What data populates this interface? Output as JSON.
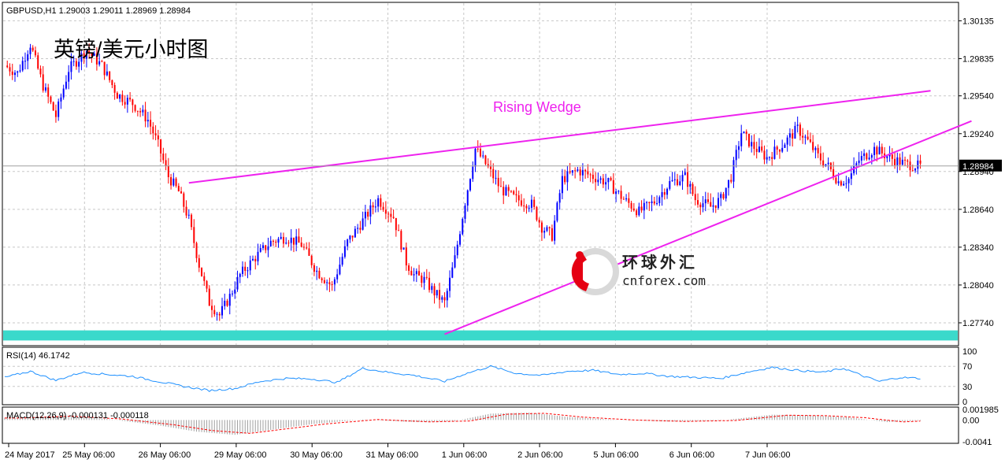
{
  "header": {
    "symbol_line": "GBPUSD,H1  1.29003 1.29011 1.28969 1.28984",
    "cn_title": "英镑/美元小时图"
  },
  "annotations": {
    "pattern_label": "Rising Wedge",
    "watermark_cn": "环球外汇",
    "watermark_url": "cnforex.com"
  },
  "price_axis": {
    "ticks": [
      "1.30135",
      "1.29835",
      "1.29540",
      "1.29240",
      "1.28940",
      "1.28640",
      "1.28340",
      "1.28040",
      "1.27740"
    ],
    "tick_values": [
      1.30135,
      1.29835,
      1.2954,
      1.2924,
      1.2894,
      1.2864,
      1.2834,
      1.2804,
      1.2774
    ],
    "current_price": "1.28984",
    "current_value": 1.28984,
    "range": [
      1.2759,
      1.3025
    ]
  },
  "time_axis": {
    "labels": [
      "24 May 2017",
      "25 May 06:00",
      "26 May 06:00",
      "29 May 06:00",
      "30 May 06:00",
      "31 May 06:00",
      "1 Jun 06:00",
      "2 Jun 06:00",
      "5 Jun 06:00",
      "6 Jun 06:00",
      "7 Jun 06:00"
    ]
  },
  "rsi_panel": {
    "label": "RSI(14) 46.1742",
    "ticks": [
      "100",
      "70",
      "30",
      "0"
    ],
    "tick_values": [
      100,
      70,
      30,
      0
    ]
  },
  "macd_panel": {
    "label": "MACD(12,26,9) -0.000131 -0.000118",
    "ticks": [
      "0.001985",
      "0.00",
      "-0.0041"
    ],
    "tick_values": [
      0.001985,
      0,
      -0.0041
    ]
  },
  "colors": {
    "bull": "#0000ff",
    "bear": "#ff0000",
    "wedge": "#ee22ee",
    "support_band": "#3ad9cb",
    "rsi_line": "#1e90ff",
    "macd_signal": "#ff0000",
    "macd_hist": "#a0a0a0"
  },
  "chart_data": {
    "type": "candlestick",
    "symbol": "GBPUSD",
    "timeframe": "H1",
    "ohlc_last": {
      "open": 1.29003,
      "high": 1.29011,
      "low": 1.28969,
      "close": 1.28984
    },
    "ylim": [
      1.2759,
      1.3025
    ],
    "path_points": [
      [
        0,
        1.2978
      ],
      [
        5,
        1.2972
      ],
      [
        10,
        1.2995
      ],
      [
        15,
        1.2962
      ],
      [
        20,
        1.2938
      ],
      [
        25,
        1.2975
      ],
      [
        32,
        1.299
      ],
      [
        38,
        1.2978
      ],
      [
        44,
        1.2955
      ],
      [
        50,
        1.2948
      ],
      [
        56,
        1.2935
      ],
      [
        60,
        1.2915
      ],
      [
        64,
        1.289
      ],
      [
        68,
        1.2878
      ],
      [
        72,
        1.2856
      ],
      [
        76,
        1.282
      ],
      [
        80,
        1.279
      ],
      [
        84,
        1.278
      ],
      [
        88,
        1.2795
      ],
      [
        92,
        1.2812
      ],
      [
        98,
        1.2826
      ],
      [
        104,
        1.2838
      ],
      [
        110,
        1.2842
      ],
      [
        116,
        1.2836
      ],
      [
        122,
        1.2815
      ],
      [
        128,
        1.2803
      ],
      [
        134,
        1.2838
      ],
      [
        140,
        1.2855
      ],
      [
        146,
        1.2872
      ],
      [
        152,
        1.2858
      ],
      [
        157,
        1.2822
      ],
      [
        160,
        1.2812
      ],
      [
        164,
        1.2808
      ],
      [
        168,
        1.2798
      ],
      [
        172,
        1.279
      ],
      [
        176,
        1.2825
      ],
      [
        180,
        1.287
      ],
      [
        184,
        1.2912
      ],
      [
        188,
        1.29
      ],
      [
        194,
        1.288
      ],
      [
        200,
        1.2872
      ],
      [
        206,
        1.2868
      ],
      [
        210,
        1.285
      ],
      [
        214,
        1.2843
      ],
      [
        218,
        1.2888
      ],
      [
        224,
        1.2895
      ],
      [
        230,
        1.289
      ],
      [
        236,
        1.2885
      ],
      [
        242,
        1.2872
      ],
      [
        248,
        1.2862
      ],
      [
        254,
        1.287
      ],
      [
        260,
        1.2885
      ],
      [
        266,
        1.289
      ],
      [
        270,
        1.2872
      ],
      [
        276,
        1.2866
      ],
      [
        280,
        1.2872
      ],
      [
        284,
        1.289
      ],
      [
        288,
        1.2925
      ],
      [
        292,
        1.2915
      ],
      [
        298,
        1.2905
      ],
      [
        304,
        1.2915
      ],
      [
        310,
        1.2928
      ],
      [
        314,
        1.2918
      ],
      [
        318,
        1.2906
      ],
      [
        322,
        1.2898
      ],
      [
        326,
        1.2886
      ],
      [
        330,
        1.2888
      ],
      [
        334,
        1.2903
      ],
      [
        340,
        1.2912
      ],
      [
        346,
        1.2905
      ],
      [
        352,
        1.29
      ],
      [
        358,
        1.2898
      ]
    ],
    "x_index_max": 372,
    "rising_wedge": {
      "upper": {
        "from": [
          72,
          1.2885
        ],
        "to": [
          362,
          1.2958
        ]
      },
      "lower": {
        "from": [
          172,
          1.2765
        ],
        "to": [
          378,
          1.2934
        ]
      }
    },
    "support_band": [
      1.276,
      1.2768
    ],
    "rsi": {
      "value": 46.1742,
      "path_points": [
        [
          0,
          48
        ],
        [
          10,
          60
        ],
        [
          20,
          42
        ],
        [
          30,
          58
        ],
        [
          40,
          54
        ],
        [
          50,
          50
        ],
        [
          60,
          40
        ],
        [
          70,
          30
        ],
        [
          80,
          22
        ],
        [
          90,
          26
        ],
        [
          100,
          40
        ],
        [
          110,
          46
        ],
        [
          120,
          45
        ],
        [
          130,
          38
        ],
        [
          140,
          66
        ],
        [
          150,
          58
        ],
        [
          160,
          52
        ],
        [
          172,
          40
        ],
        [
          180,
          55
        ],
        [
          190,
          70
        ],
        [
          200,
          56
        ],
        [
          210,
          52
        ],
        [
          220,
          60
        ],
        [
          230,
          62
        ],
        [
          240,
          54
        ],
        [
          250,
          56
        ],
        [
          260,
          50
        ],
        [
          270,
          48
        ],
        [
          280,
          46
        ],
        [
          290,
          58
        ],
        [
          300,
          68
        ],
        [
          310,
          62
        ],
        [
          320,
          58
        ],
        [
          328,
          66
        ],
        [
          336,
          50
        ],
        [
          342,
          40
        ],
        [
          350,
          48
        ],
        [
          358,
          46
        ]
      ]
    },
    "macd": {
      "main": -0.000131,
      "signal": -0.000118,
      "hist_path_points": [
        [
          0,
          0.0004
        ],
        [
          20,
          0.0008
        ],
        [
          40,
          0.0002
        ],
        [
          60,
          -0.001
        ],
        [
          75,
          -0.0022
        ],
        [
          90,
          -0.0028
        ],
        [
          105,
          -0.0018
        ],
        [
          120,
          -0.0008
        ],
        [
          140,
          0.0001
        ],
        [
          160,
          -0.0004
        ],
        [
          176,
          -0.0002
        ],
        [
          190,
          0.0012
        ],
        [
          205,
          0.0014
        ],
        [
          220,
          0.0006
        ],
        [
          240,
          0.0
        ],
        [
          260,
          -0.0003
        ],
        [
          280,
          -0.0001
        ],
        [
          300,
          0.001
        ],
        [
          315,
          0.0009
        ],
        [
          330,
          0.0005
        ],
        [
          345,
          -0.0004
        ],
        [
          358,
          -0.0001
        ]
      ]
    }
  }
}
